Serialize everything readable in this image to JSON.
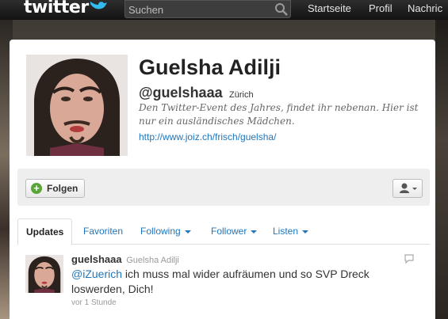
{
  "topbar": {
    "logo": "twitter",
    "search_placeholder": "Suchen",
    "nav": [
      "Startseite",
      "Profil",
      "Nachric"
    ]
  },
  "profile": {
    "name": "Guelsha Adilji",
    "handle": "@guelshaaa",
    "location": "Zürich",
    "bio": "Den Twitter-Event des Jahres, findet ihr nebenan. Hier ist nur ein ausländisches Mädchen.",
    "url": "http://www.joiz.ch/frisch/guelsha/"
  },
  "actions": {
    "follow_label": "Folgen"
  },
  "tabs": [
    {
      "label": "Updates",
      "active": true,
      "dropdown": false
    },
    {
      "label": "Favoriten",
      "active": false,
      "dropdown": false
    },
    {
      "label": "Following",
      "active": false,
      "dropdown": true
    },
    {
      "label": "Follower",
      "active": false,
      "dropdown": true
    },
    {
      "label": "Listen",
      "active": false,
      "dropdown": true
    }
  ],
  "tweet": {
    "username": "guelshaaa",
    "display_name": "Guelsha Adilji",
    "mention": "@iZuerich",
    "text": " ich muss mal wider aufräumen und so SVP Dreck loswerden, Dich!",
    "time": "vor 1 Stunde"
  },
  "colors": {
    "link": "#2276bb",
    "follow_plus": "#5aa537",
    "topbar": "#1a1a1a"
  }
}
